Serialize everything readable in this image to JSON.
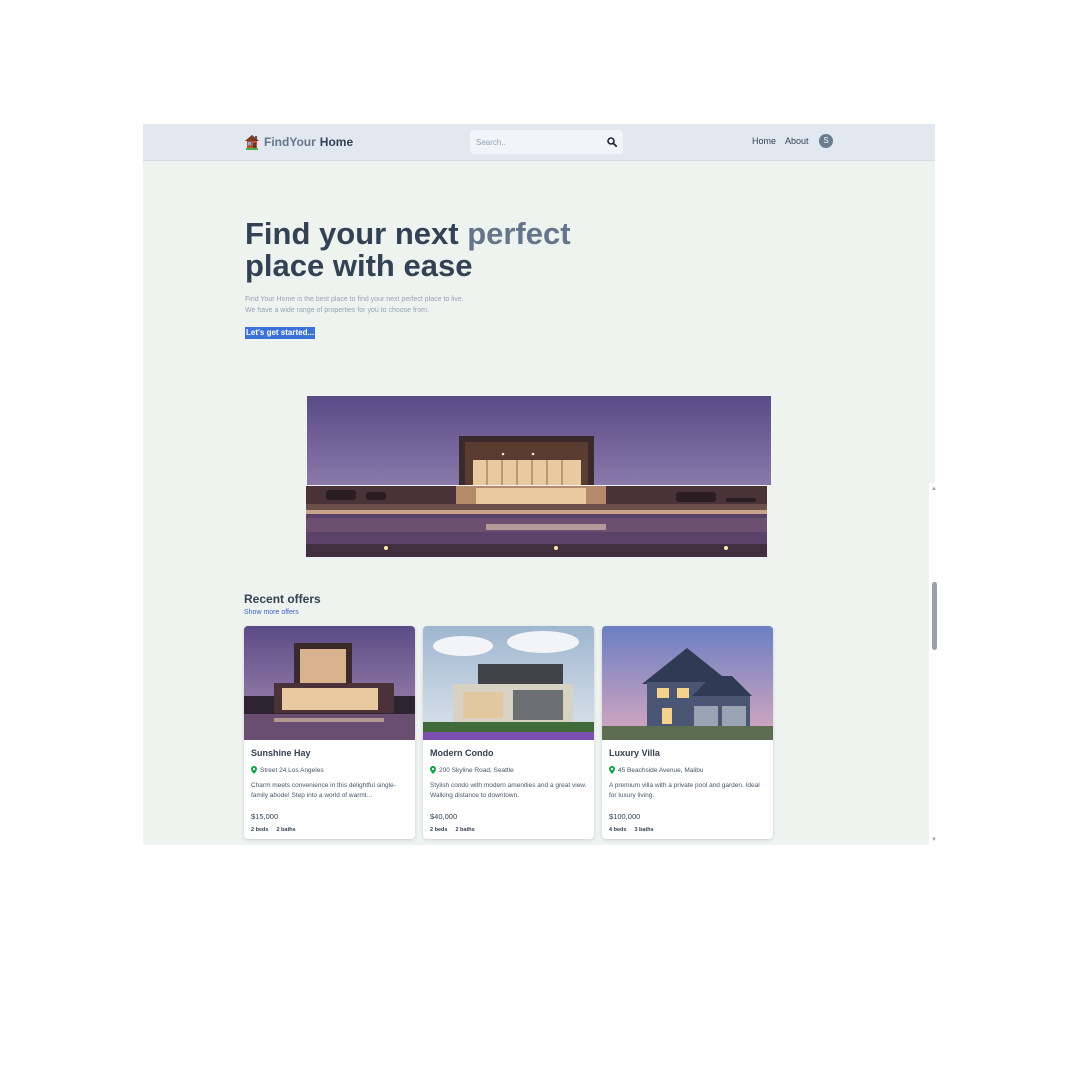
{
  "header": {
    "logo_part1": "FindYour",
    "logo_part2": "Home",
    "search_placeholder": "Search..",
    "nav_home": "Home",
    "nav_about": "About",
    "avatar_initial": "S"
  },
  "hero": {
    "title_part1": "Find your next ",
    "title_highlight": "perfect",
    "title_part2": "place with ease",
    "desc_line1": "Find Your Home is the best place to find your next perfect place to live.",
    "desc_line2": "We have a wide range of properties for you to choose from.",
    "cta": "Let's get started..."
  },
  "offers": {
    "title": "Recent offers",
    "show_more": "Show more offers",
    "cards": [
      {
        "name": "Sunshine Hay",
        "address": "Street 24 Los Angeles",
        "description": "Charm meets convenience in this delightful single-family abode! Step into a world of warmt...",
        "price": "$15,000",
        "beds": "2 beds",
        "baths": "2 baths"
      },
      {
        "name": "Modern Condo",
        "address": "200 Skyline Road, Seattle",
        "description": "Stylish condo with modern amenities and a great view. Walking distance to downtown.",
        "price": "$40,000",
        "beds": "2 beds",
        "baths": "2 baths"
      },
      {
        "name": "Luxury Villa",
        "address": "45 Beachside Avenue, Malibu",
        "description": "A premium villa with a private pool and garden. Ideal for luxury living.",
        "price": "$100,000",
        "beds": "4 beds",
        "baths": "3 baths"
      }
    ]
  },
  "colors": {
    "header_bg": "#e2e8f0",
    "page_bg": "#eff3f0",
    "text_dark": "#334155",
    "text_muted": "#64748b",
    "link": "#3b5fc4",
    "cta_bg": "#3b72d9",
    "pin_green": "#16a34a"
  }
}
